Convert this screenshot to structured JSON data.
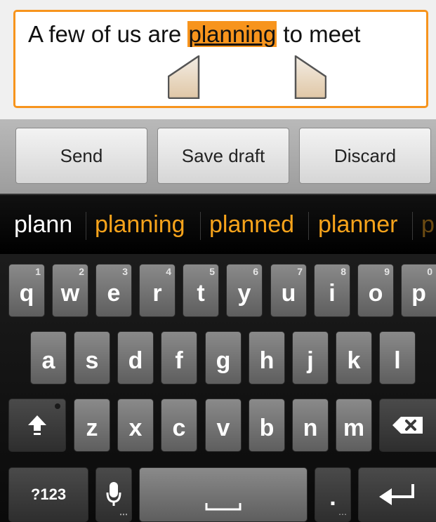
{
  "compose": {
    "text_before": "A few of us are ",
    "text_selected": "planning",
    "text_after": " to meet"
  },
  "actions": {
    "send_label": "Send",
    "save_draft_label": "Save draft",
    "discard_label": "Discard"
  },
  "suggestions": {
    "typed": "plann",
    "items": [
      "planning",
      "planned",
      "planner",
      "p"
    ]
  },
  "keyboard": {
    "row1": [
      {
        "label": "q",
        "num": "1"
      },
      {
        "label": "w",
        "num": "2"
      },
      {
        "label": "e",
        "num": "3"
      },
      {
        "label": "r",
        "num": "4"
      },
      {
        "label": "t",
        "num": "5"
      },
      {
        "label": "y",
        "num": "6"
      },
      {
        "label": "u",
        "num": "7"
      },
      {
        "label": "i",
        "num": "8"
      },
      {
        "label": "o",
        "num": "9"
      },
      {
        "label": "p",
        "num": "0"
      }
    ],
    "row2": [
      "a",
      "s",
      "d",
      "f",
      "g",
      "h",
      "j",
      "k",
      "l"
    ],
    "row3": [
      "z",
      "x",
      "c",
      "v",
      "b",
      "n",
      "m"
    ],
    "symbols_label": "?123",
    "period_label": ".",
    "shift_icon": "shift-arrow-icon",
    "backspace_icon": "backspace-icon",
    "mic_icon": "microphone-icon",
    "enter_icon": "enter-icon"
  },
  "colors": {
    "accent": "#f7941d",
    "suggestion_typed": "#ffffff",
    "suggestion_item": "#f7a31b"
  }
}
